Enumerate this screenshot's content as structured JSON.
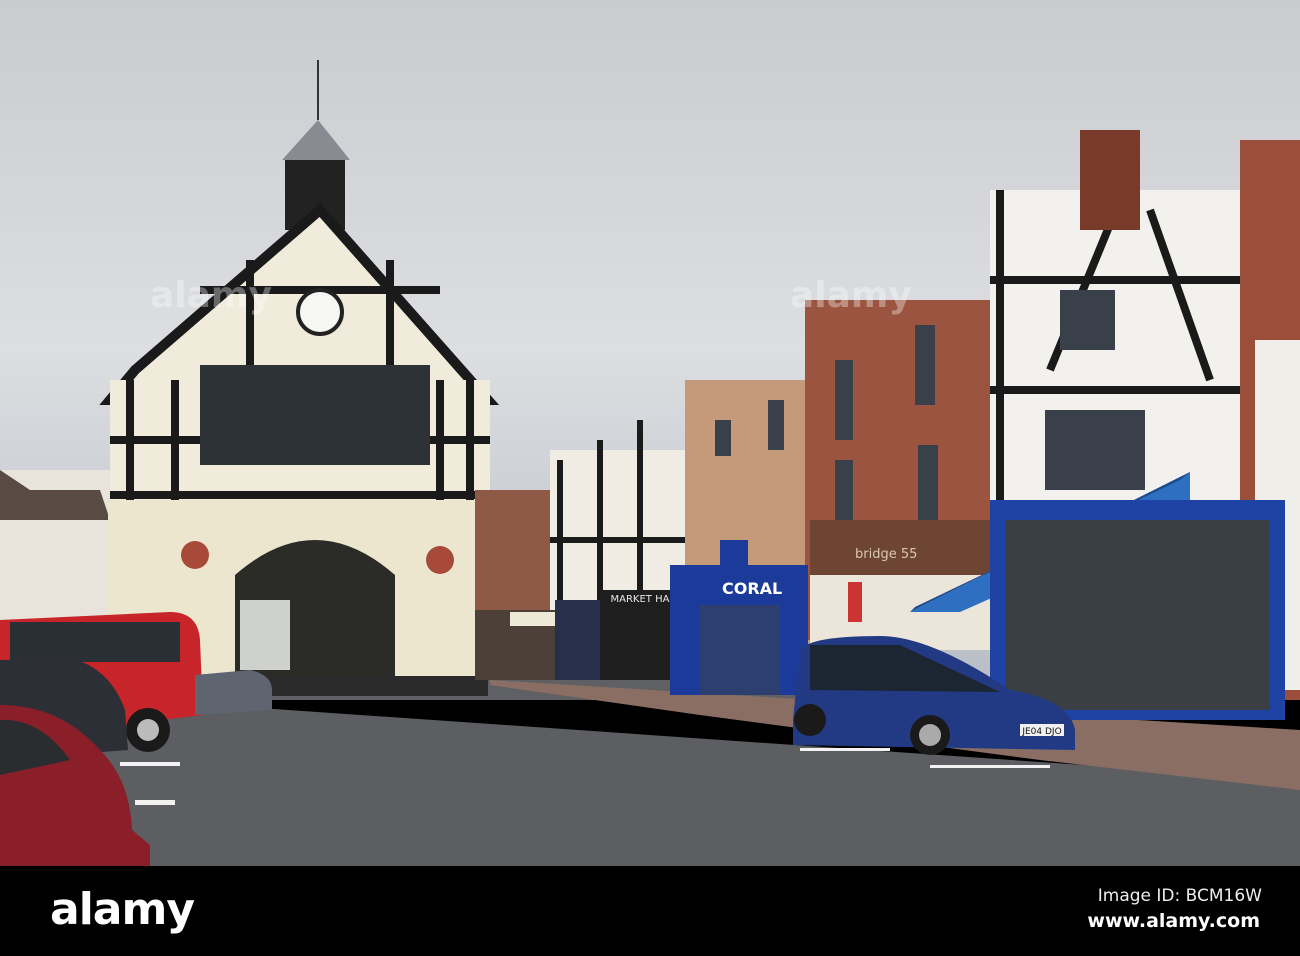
{
  "photo": {
    "signs": {
      "coral": "CORAL",
      "market_hall": "MARKET HA",
      "bridge": "bridge 55",
      "plate": "JE04 DJO"
    }
  },
  "watermark": {
    "logo": "alamy",
    "overlay_text": "alamy",
    "image_id": "Image ID: BCM16W",
    "url": "www.alamy.com"
  },
  "colors": {
    "sky": "#d4d6da",
    "road": "#5b5d60",
    "coral_blue": "#1b3a9a",
    "awning": "#2f6fc2"
  }
}
